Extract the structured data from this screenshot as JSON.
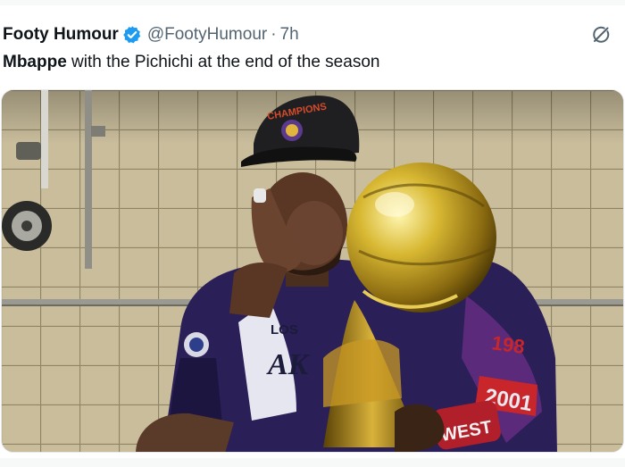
{
  "tweet": {
    "display_name": "Footy Humour",
    "handle": "@FootyHumour",
    "separator": "·",
    "time": "7h",
    "text_bold": "Mbappe",
    "text_rest": " with the Pichichi at the end of the season"
  },
  "icons": {
    "verified": "verified-badge-icon",
    "grok": "grok-icon"
  },
  "colors": {
    "verified_blue": "#1d9bf0",
    "secondary_text": "#536471",
    "primary_text": "#0f1419"
  },
  "media": {
    "cap_text": "CHAMPIONS",
    "jacket_left_text": "LOS",
    "jacket_left_text2": "AK",
    "jacket_right_text": "198",
    "jacket_right_text2": "2001",
    "wristband_text": "WEST"
  }
}
